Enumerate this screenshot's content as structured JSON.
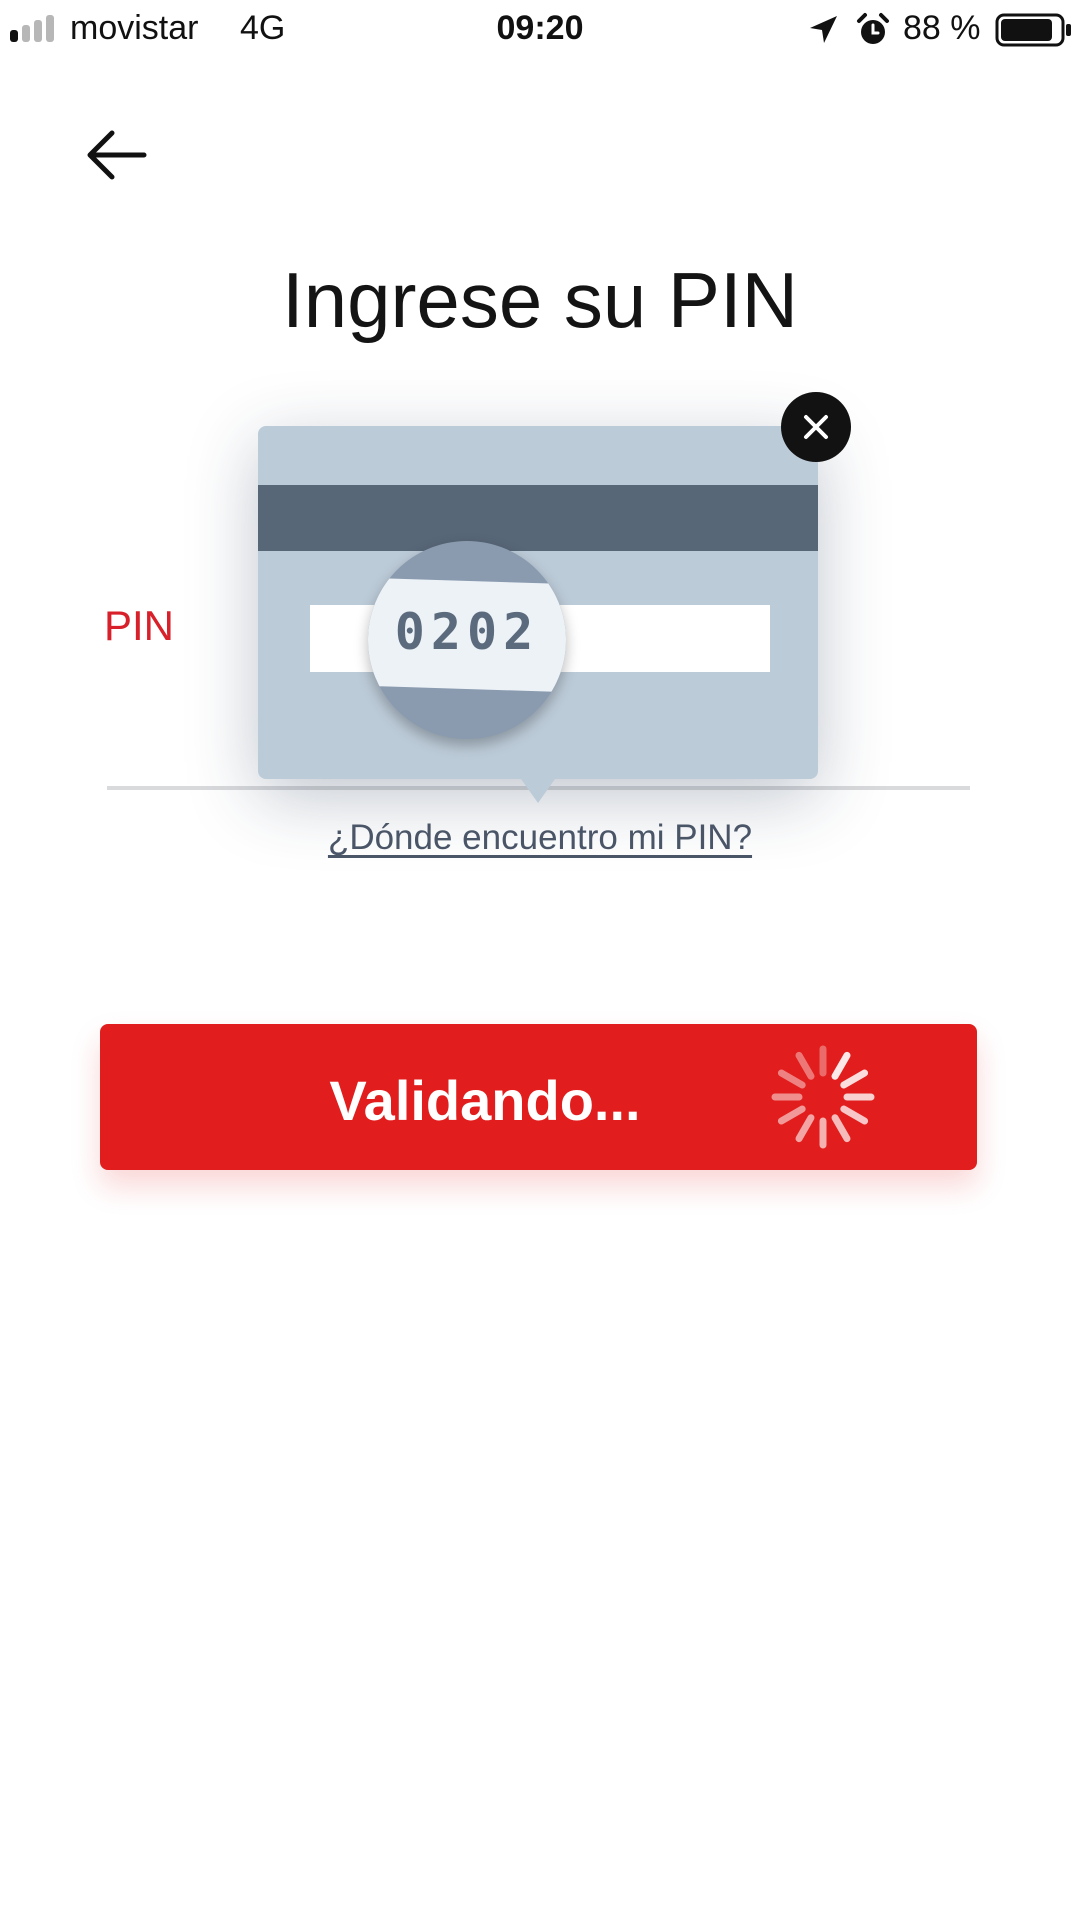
{
  "status_bar": {
    "carrier": "movistar",
    "network": "4G",
    "time": "09:20",
    "battery_percent": "88 %",
    "battery_level": 0.88,
    "icons": [
      "signal-icon",
      "location-arrow-icon",
      "alarm-clock-icon",
      "battery-icon"
    ]
  },
  "header": {
    "back_icon": "arrow-left-icon",
    "title": "Ingrese su PIN"
  },
  "pin_field": {
    "label": "PIN",
    "help_link": "¿Dónde encuentro mi PIN?"
  },
  "card_hint": {
    "sample_code": "0202",
    "close_icon": "close-icon"
  },
  "submit_button": {
    "label": "Validando...",
    "state": "loading",
    "spinner_icon": "spinner-icon"
  },
  "colors": {
    "accent_red": "#e11d1d",
    "label_red": "#d8202a",
    "card_bg": "#bccbd8",
    "card_stripe": "#586778",
    "link_color": "#4a5668"
  }
}
